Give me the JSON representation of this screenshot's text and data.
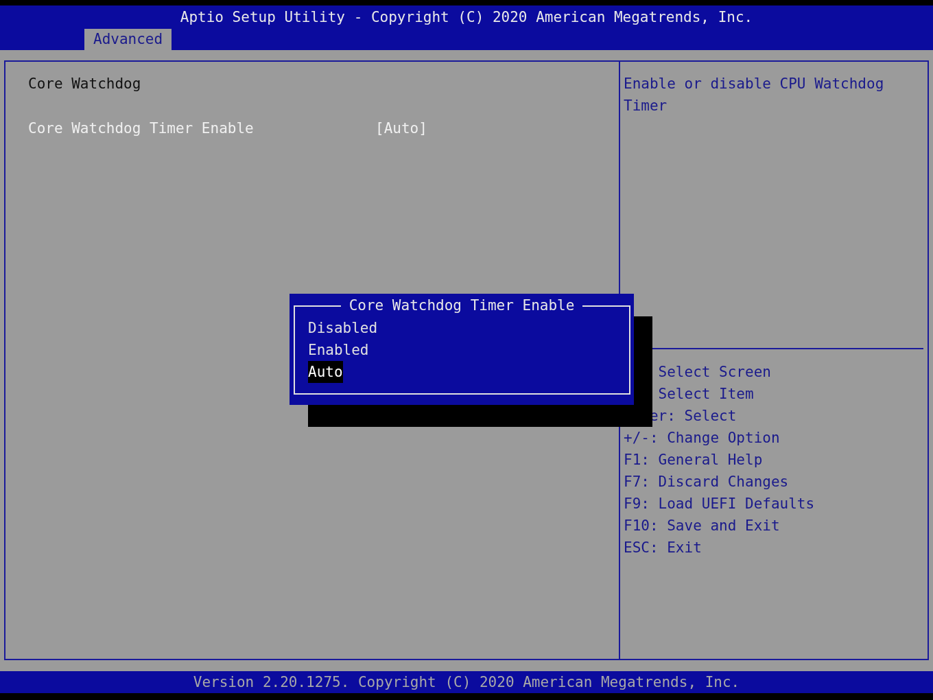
{
  "header": {
    "title": "Aptio Setup Utility - Copyright (C) 2020 American Megatrends, Inc."
  },
  "tabs": [
    {
      "label": "Advanced",
      "selected": true
    }
  ],
  "settings": [
    {
      "kind": "heading",
      "label": "Core Watchdog"
    },
    {
      "kind": "option",
      "label": "Core Watchdog Timer Enable",
      "value": "[Auto]"
    }
  ],
  "help_text": "Enable or disable CPU Watchdog Timer",
  "key_help": [
    "Select Screen",
    "Select Item",
    "er: Select",
    "+/-: Change Option",
    "F1: General Help",
    "F7: Discard Changes",
    "F9: Load UEFI Defaults",
    "F10: Save and Exit",
    "ESC: Exit"
  ],
  "popup": {
    "title": "Core Watchdog Timer Enable",
    "options": [
      {
        "label": "Disabled",
        "selected": false
      },
      {
        "label": "Enabled",
        "selected": false
      },
      {
        "label": "Auto",
        "selected": true
      }
    ]
  },
  "footer": "Version 2.20.1275. Copyright (C) 2020 American Megatrends, Inc."
}
